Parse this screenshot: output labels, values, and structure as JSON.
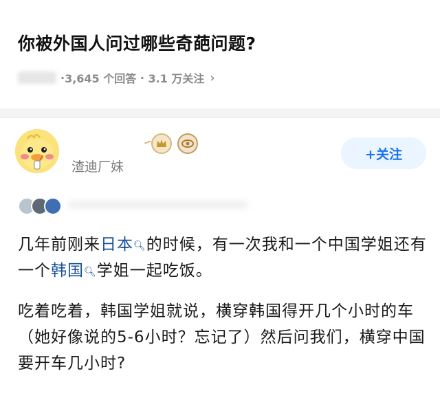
{
  "question": {
    "title": "你被外国人问过哪些奇葩问题?",
    "answers_count": "3,645 个回答",
    "followers": "3.1 万关注"
  },
  "answer": {
    "author_name": "渣迪厂妹",
    "follow_label": "+关注",
    "paragraph1": {
      "part1": "几年前刚来",
      "keyword1": "日本",
      "part2": "的时候，有一次我和一个中国学姐还有一个",
      "keyword2": "韩国",
      "part3": "学姐一起吃饭。"
    },
    "paragraph2": "吃着吃着，韩国学姐就说，横穿韩国得开几个小时的车（她好像说的5-6小时？忘记了）然后问我们，横穿中国要开车几小时?"
  },
  "colors": {
    "link": "#175199",
    "follow_text": "#1772f6",
    "follow_bg": "#ebf5ff"
  },
  "icons": [
    "search-icon",
    "chevron-right-icon",
    "crown-badge-icon",
    "eye-badge-icon"
  ]
}
